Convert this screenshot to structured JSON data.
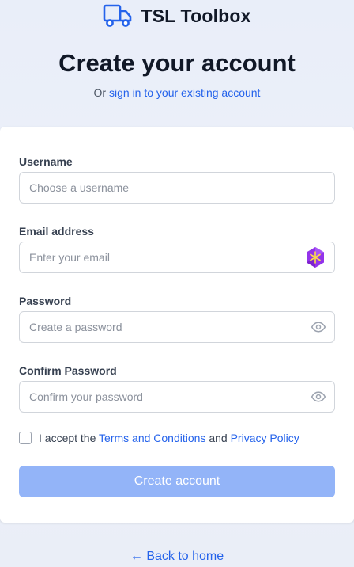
{
  "brand": {
    "name": "TSL Toolbox",
    "logo_icon": "truck-icon",
    "accent": "#2563eb"
  },
  "heading": "Create your account",
  "subline": {
    "prefix": "Or",
    "link": "sign in to your existing account"
  },
  "form": {
    "username": {
      "label": "Username",
      "placeholder": "Choose a username",
      "value": ""
    },
    "email": {
      "label": "Email address",
      "placeholder": "Enter your email",
      "value": "",
      "trailing_icon": "password-manager-icon"
    },
    "password": {
      "label": "Password",
      "placeholder": "Create a password",
      "value": "",
      "trailing_icon": "eye-icon"
    },
    "confirm_password": {
      "label": "Confirm Password",
      "placeholder": "Confirm your password",
      "value": "",
      "trailing_icon": "eye-icon"
    },
    "terms": {
      "prefix": "I accept the",
      "terms_link": "Terms and Conditions",
      "joiner": "and",
      "privacy_link": "Privacy Policy",
      "checked": false
    },
    "submit_label": "Create account"
  },
  "back_link": {
    "arrow": "←",
    "label": "Back to home"
  }
}
